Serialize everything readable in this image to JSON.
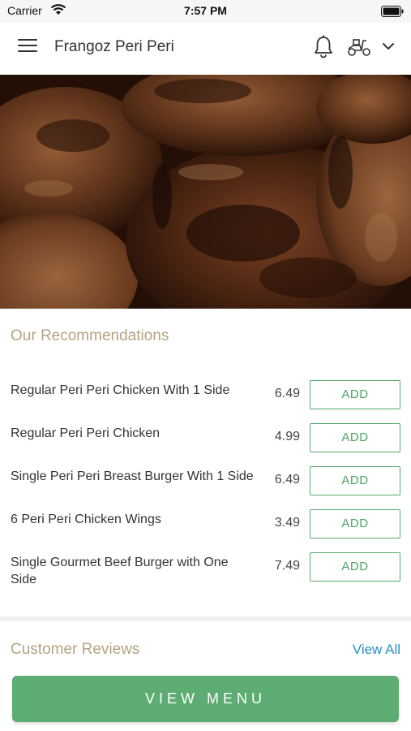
{
  "status_bar": {
    "carrier": "Carrier",
    "time": "7:57 PM"
  },
  "header": {
    "title": "Frangoz Peri Peri"
  },
  "recommendations": {
    "title": "Our Recommendations",
    "add_label": "ADD",
    "items": [
      {
        "name": "Regular Peri Peri Chicken With 1 Side",
        "price": "6.49"
      },
      {
        "name": "Regular Peri Peri Chicken",
        "price": "4.99"
      },
      {
        "name": "Single Peri Peri Breast Burger With 1 Side",
        "price": "6.49"
      },
      {
        "name": "6 Peri Peri Chicken Wings",
        "price": "3.49"
      },
      {
        "name": "Single Gourmet Beef Burger with One Side",
        "price": "7.49"
      }
    ]
  },
  "reviews": {
    "title": "Customer Reviews",
    "view_all": "View All"
  },
  "footer": {
    "view_menu": "VIEW MENU"
  },
  "colors": {
    "accent_green": "#5dac73",
    "section_title": "#b4a381",
    "link_blue": "#2a8fc8"
  },
  "icons": [
    "wifi-icon",
    "battery-icon",
    "menu-icon",
    "bell-icon",
    "scooter-icon",
    "chevron-down-icon"
  ]
}
